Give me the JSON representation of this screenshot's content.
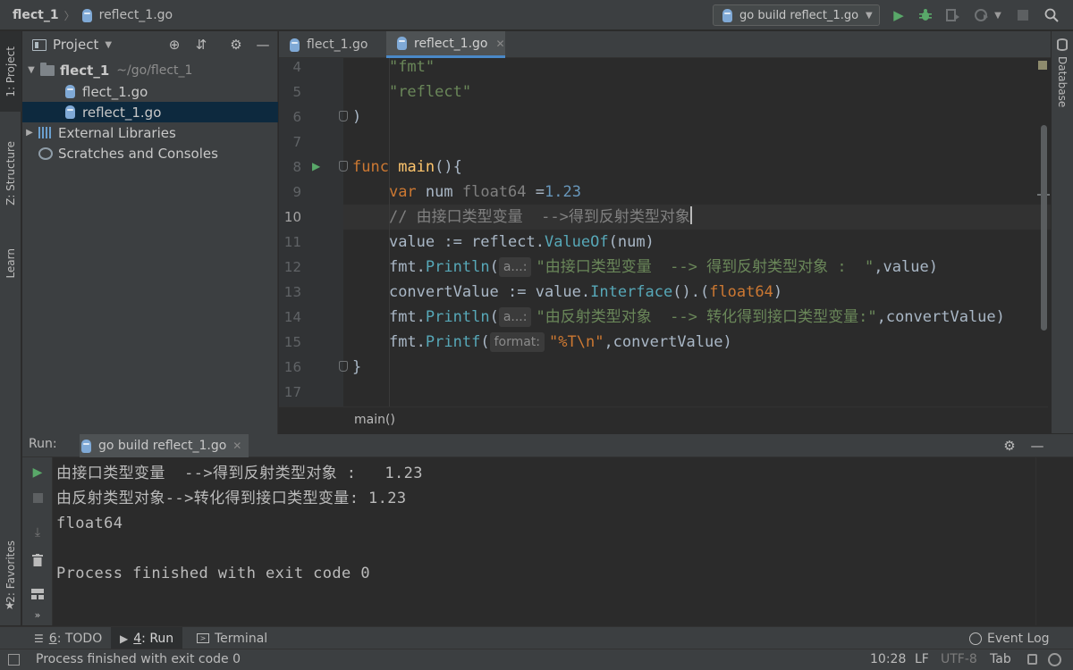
{
  "window": {
    "breadcrumb_project": "flect_1",
    "breadcrumb_file": "reflect_1.go"
  },
  "toolbar": {
    "run_config": "go build reflect_1.go",
    "icons": [
      "run-icon",
      "debug-icon",
      "coverage-icon",
      "profile-icon",
      "stop-icon",
      "search-icon"
    ]
  },
  "left_stripe": {
    "project_tab": "1: Project",
    "structure_tab": "Z: Structure",
    "learn_tab": "Learn",
    "favorites_tab": "2: Favorites"
  },
  "right_stripe": {
    "database_tab": "Database"
  },
  "project_panel": {
    "title": "Project",
    "tree": [
      {
        "label": "flect_1",
        "path": "~/go/flect_1",
        "kind": "folder"
      },
      {
        "label": "flect_1.go",
        "kind": "go-file"
      },
      {
        "label": "reflect_1.go",
        "kind": "go-file",
        "selected": true
      },
      {
        "label": "External Libraries",
        "kind": "libraries"
      },
      {
        "label": "Scratches and Consoles",
        "kind": "scratches"
      }
    ]
  },
  "editor": {
    "tabs": [
      {
        "label": "flect_1.go",
        "active": false
      },
      {
        "label": "reflect_1.go",
        "active": true
      }
    ],
    "current_line": "10",
    "line_numbers": [
      "4",
      "5",
      "6",
      "7",
      "8",
      "9",
      "10",
      "11",
      "12",
      "13",
      "14",
      "15",
      "16",
      "17"
    ],
    "code": {
      "l4_str": "\"fmt\"",
      "l5_str": "\"reflect\"",
      "l6": ")",
      "l8_kw": "func",
      "l8_fn": "main",
      "l8_rest": "(){",
      "l9_kw": "var",
      "l9_name": " num ",
      "l9_type": "float64",
      "l9_eq": " =",
      "l9_num": "1.23",
      "l10_comment": "// 由接口类型变量  -->得到反射类型对象",
      "l11_a": "value := reflect.",
      "l11_call": "ValueOf",
      "l11_b": "(num)",
      "l12_a": "fmt.",
      "l12_call": "Println",
      "l12_b": "(",
      "l12_hint": "a...:",
      "l12_str": "\"由接口类型变量  --> 得到反射类型对象 :  \"",
      "l12_c": ",value)",
      "l13_a": "convertValue := value.",
      "l13_call": "Interface",
      "l13_b": "().(",
      "l13_kw": "float64",
      "l13_c": ")",
      "l14_a": "fmt.",
      "l14_call": "Println",
      "l14_b": "(",
      "l14_hint": "a...:",
      "l14_str": "\"由反射类型对象  --> 转化得到接口类型变量:\"",
      "l14_c": ",convertValue)",
      "l15_a": "fmt.",
      "l15_call": "Printf",
      "l15_b": "(",
      "l15_hint": "format:",
      "l15_str": "\"%T\\n\"",
      "l15_c": ",convertValue)",
      "l16": "}"
    },
    "breadcrumb": "main()"
  },
  "run_panel": {
    "label": "Run:",
    "tab": "go build reflect_1.go",
    "output": [
      "由接口类型变量  -->得到反射类型对象 :   1.23",
      "由反射类型对象-->转化得到接口类型变量: 1.23",
      "float64",
      "",
      "Process finished with exit code 0"
    ]
  },
  "bottom_tabs": [
    {
      "num": "6",
      "rest": ": TODO"
    },
    {
      "num": "4",
      "rest": ": Run"
    },
    {
      "label": "Terminal"
    },
    {
      "label": "Event Log"
    }
  ],
  "status_bar": {
    "message": "Process finished with exit code 0",
    "position": "10:28",
    "line_sep": "LF",
    "encoding": "UTF-8",
    "indent": "Tab"
  },
  "colors": {
    "run_green": "#59a869",
    "selection_blue": "#0d293e",
    "tab_underline": "#4a88c7",
    "keyword": "#cc7832",
    "string": "#6a8759",
    "number": "#6897bb",
    "function": "#ffc66d"
  }
}
